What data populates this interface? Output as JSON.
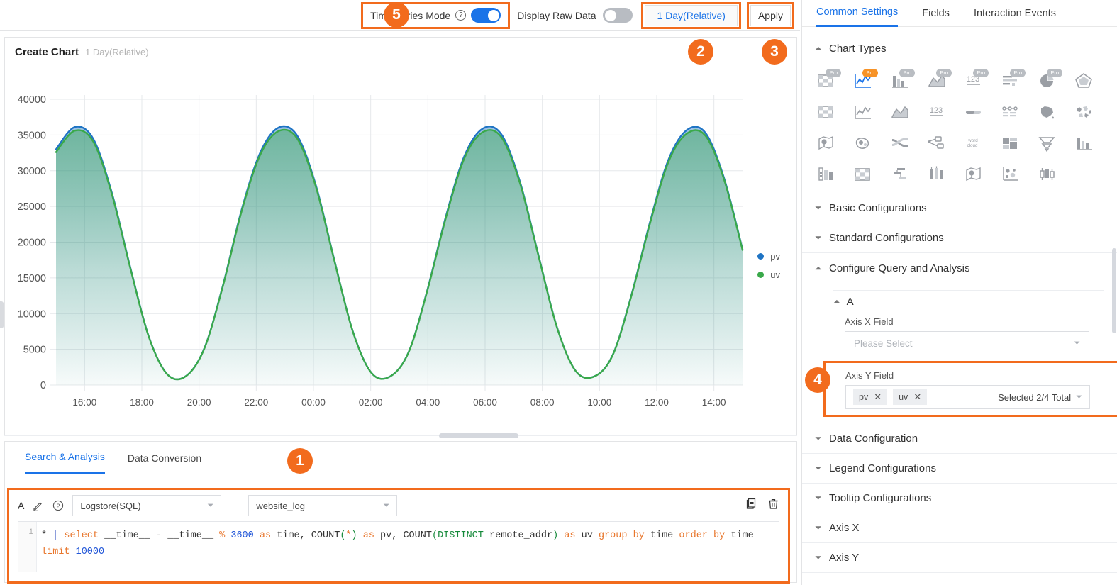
{
  "toolbar": {
    "time_series_mode_label": "Time Series Mode",
    "time_series_mode_on": "on",
    "display_raw_data_label": "Display Raw Data",
    "display_raw_data_on": "off",
    "time_range_label": "1 Day(Relative)",
    "apply_label": "Apply"
  },
  "badges": {
    "b1": "1",
    "b2": "2",
    "b3": "3",
    "b4": "4",
    "b5": "5"
  },
  "chart_card": {
    "title": "Create Chart",
    "subtitle": "1 Day(Relative)"
  },
  "chart_data": {
    "type": "area",
    "title": "Create Chart",
    "subtitle": "1 Day(Relative)",
    "xlabel": "",
    "ylabel": "",
    "ylim": [
      0,
      40000
    ],
    "y_ticks": [
      0,
      5000,
      10000,
      15000,
      20000,
      25000,
      30000,
      35000,
      40000
    ],
    "x_ticks": [
      "16:00",
      "18:00",
      "20:00",
      "22:00",
      "00:00",
      "02:00",
      "04:00",
      "06:00",
      "08:00",
      "10:00",
      "12:00",
      "14:00"
    ],
    "grid": true,
    "legend_position": "right",
    "series": [
      {
        "name": "pv",
        "color": "#1f74c4",
        "values": [
          33000,
          36100,
          34500,
          27000,
          16500,
          6800,
          1500,
          1250,
          5200,
          14000,
          24500,
          32500,
          36050,
          34900,
          28000,
          17500,
          7500,
          1700,
          1200,
          4600,
          13200,
          23500,
          32000,
          35900,
          35100,
          28500,
          18200,
          8100,
          2000,
          1200,
          4200,
          12500,
          22700,
          31500,
          35700,
          35300,
          29000,
          19000
        ]
      },
      {
        "name": "uv",
        "color": "#3aa94a",
        "values": [
          32600,
          35600,
          34100,
          26800,
          16400,
          6750,
          1480,
          1240,
          5150,
          13900,
          24300,
          32200,
          35550,
          34500,
          27800,
          17400,
          7450,
          1690,
          1190,
          4570,
          13100,
          23300,
          31700,
          35400,
          34700,
          28300,
          18100,
          8050,
          1990,
          1190,
          4170,
          12400,
          22500,
          31200,
          35200,
          34900,
          28800,
          18900
        ]
      }
    ],
    "legend": [
      {
        "label": "pv",
        "color": "#1f74c4"
      },
      {
        "label": "uv",
        "color": "#3aa94a"
      }
    ]
  },
  "bottom_panel": {
    "tabs": [
      {
        "label": "Search & Analysis",
        "active": true
      },
      {
        "label": "Data Conversion",
        "active": false
      }
    ],
    "query_letter": "A",
    "source_type": "Logstore(SQL)",
    "logstore": "website_log",
    "line_number": "1",
    "sql_tokens": [
      {
        "t": "* ",
        "c": "op"
      },
      {
        "t": "| ",
        "c": "pipe"
      },
      {
        "t": "select ",
        "c": "kw"
      },
      {
        "t": "__time__ - __time__ ",
        "c": "op"
      },
      {
        "t": "% ",
        "c": "kw"
      },
      {
        "t": "3600 ",
        "c": "num"
      },
      {
        "t": "as ",
        "c": "kw"
      },
      {
        "t": "time, ",
        "c": "op"
      },
      {
        "t": "COUNT",
        "c": "op"
      },
      {
        "t": "(",
        "c": "fn"
      },
      {
        "t": "*",
        "c": "kw"
      },
      {
        "t": ") ",
        "c": "fn"
      },
      {
        "t": "as ",
        "c": "kw"
      },
      {
        "t": "pv, ",
        "c": "op"
      },
      {
        "t": "COUNT",
        "c": "op"
      },
      {
        "t": "(",
        "c": "fn"
      },
      {
        "t": "DISTINCT ",
        "c": "fn"
      },
      {
        "t": "remote_addr",
        "c": "op"
      },
      {
        "t": ") ",
        "c": "fn"
      },
      {
        "t": "as ",
        "c": "kw"
      },
      {
        "t": "uv ",
        "c": "op"
      },
      {
        "t": "group ",
        "c": "kw"
      },
      {
        "t": "by ",
        "c": "kw"
      },
      {
        "t": "time ",
        "c": "op"
      },
      {
        "t": "order ",
        "c": "kw"
      },
      {
        "t": "by ",
        "c": "kw"
      },
      {
        "t": "time ",
        "c": "op"
      },
      {
        "t": "limit ",
        "c": "kw"
      },
      {
        "t": "10000",
        "c": "num"
      }
    ],
    "sql_plain": "* | select __time__ - __time__ % 3600 as time, COUNT(*) as pv, COUNT(DISTINCT remote_addr) as uv group by time order by time limit 10000"
  },
  "right_panel": {
    "tabs": [
      {
        "label": "Common Settings",
        "active": true
      },
      {
        "label": "Fields",
        "active": false
      },
      {
        "label": "Interaction Events",
        "active": false
      }
    ],
    "chart_types_title": "Chart Types",
    "chart_type_icons": [
      {
        "name": "table-pro-icon",
        "pro": true,
        "pro_active": false
      },
      {
        "name": "line-chart-pro-icon",
        "pro": true,
        "pro_active": true,
        "selected": true
      },
      {
        "name": "bar-chart-pro-icon",
        "pro": true,
        "pro_active": false
      },
      {
        "name": "area-chart-pro-icon",
        "pro": true,
        "pro_active": false
      },
      {
        "name": "single-value-pro-icon",
        "pro": true,
        "pro_active": false
      },
      {
        "name": "list-pro-icon",
        "pro": true,
        "pro_active": false
      },
      {
        "name": "pie-chart-pro-icon",
        "pro": true,
        "pro_active": false
      },
      {
        "name": "radar-chart-icon",
        "pro": false
      },
      {
        "name": "table-icon",
        "pro": false
      },
      {
        "name": "line-chart-icon",
        "pro": false
      },
      {
        "name": "area-chart-icon",
        "pro": false
      },
      {
        "name": "single-number-icon",
        "pro": false
      },
      {
        "name": "progress-bar-icon",
        "pro": false
      },
      {
        "name": "flow-diagram-icon",
        "pro": false
      },
      {
        "name": "china-map-icon",
        "pro": false
      },
      {
        "name": "world-map-icon",
        "pro": false
      },
      {
        "name": "map-marker-icon",
        "pro": false
      },
      {
        "name": "amoeba-icon",
        "pro": false
      },
      {
        "name": "sankey-icon",
        "pro": false
      },
      {
        "name": "topology-icon",
        "pro": false
      },
      {
        "name": "word-cloud-icon",
        "pro": false
      },
      {
        "name": "treemap-icon",
        "pro": false
      },
      {
        "name": "funnel-icon",
        "pro": false
      },
      {
        "name": "column-series-icon",
        "pro": false
      },
      {
        "name": "stacked-bar-icon",
        "pro": false
      },
      {
        "name": "grid-table-icon",
        "pro": false
      },
      {
        "name": "gantt-icon",
        "pro": false
      },
      {
        "name": "candlestick-icon",
        "pro": false
      },
      {
        "name": "geo-point-icon",
        "pro": false
      },
      {
        "name": "scatter-icon",
        "pro": false
      },
      {
        "name": "box-plot-icon",
        "pro": false
      }
    ],
    "sections": [
      {
        "label": "Basic Configurations",
        "expanded": false
      },
      {
        "label": "Standard Configurations",
        "expanded": false
      },
      {
        "label": "Configure Query and Analysis",
        "expanded": true
      }
    ],
    "query_group": {
      "label": "A",
      "axis_x_label": "Axis X Field",
      "axis_x_placeholder": "Please Select",
      "axis_y_label": "Axis Y Field",
      "axis_y_chips": [
        "pv",
        "uv"
      ],
      "axis_y_count": "Selected 2/4 Total"
    },
    "sections_bottom": [
      {
        "label": "Data Configuration",
        "expanded": false
      },
      {
        "label": "Legend Configurations",
        "expanded": false
      },
      {
        "label": "Tooltip Configurations",
        "expanded": false
      },
      {
        "label": "Axis X",
        "expanded": false
      },
      {
        "label": "Axis Y",
        "expanded": false
      }
    ]
  },
  "colors": {
    "accent_blue": "#1a73e8",
    "highlight_orange": "#f26b1d",
    "pv": "#1f74c4",
    "uv": "#3aa94a"
  }
}
